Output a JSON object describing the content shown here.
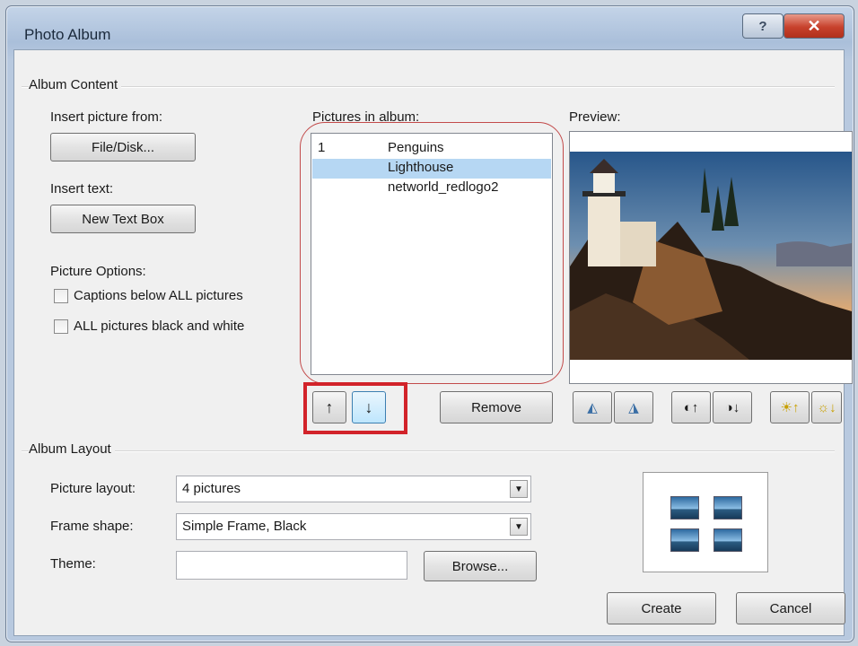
{
  "window": {
    "title": "Photo Album",
    "help_glyph": "?",
    "close_glyph": "✕"
  },
  "album_content": {
    "group_label": "Album Content",
    "insert_picture_label": "Insert picture from:",
    "file_disk_button": "File/Disk...",
    "insert_text_label": "Insert text:",
    "new_text_box_button": "New Text Box",
    "picture_options_label": "Picture Options:",
    "captions_label": "Captions below ALL pictures",
    "captions_checked": false,
    "bw_label": "ALL pictures black and white",
    "bw_checked": false,
    "pictures_label": "Pictures in album:",
    "pictures": [
      {
        "num": "1",
        "name": "Penguins",
        "selected": false
      },
      {
        "num": "",
        "name": "Lighthouse",
        "selected": true
      },
      {
        "num": "",
        "name": "networld_redlogo2",
        "selected": false
      }
    ],
    "move_up_glyph": "↑",
    "move_down_glyph": "↓",
    "remove_button": "Remove",
    "preview_label": "Preview:"
  },
  "album_layout": {
    "group_label": "Album Layout",
    "picture_layout_label": "Picture layout:",
    "picture_layout_value": "4 pictures",
    "frame_shape_label": "Frame shape:",
    "frame_shape_value": "Simple Frame, Black",
    "theme_label": "Theme:",
    "theme_value": "",
    "browse_button": "Browse..."
  },
  "footer": {
    "create_button": "Create",
    "cancel_button": "Cancel"
  },
  "colors": {
    "selection": "#b6d7f3",
    "highlight_red": "#d2232a"
  }
}
